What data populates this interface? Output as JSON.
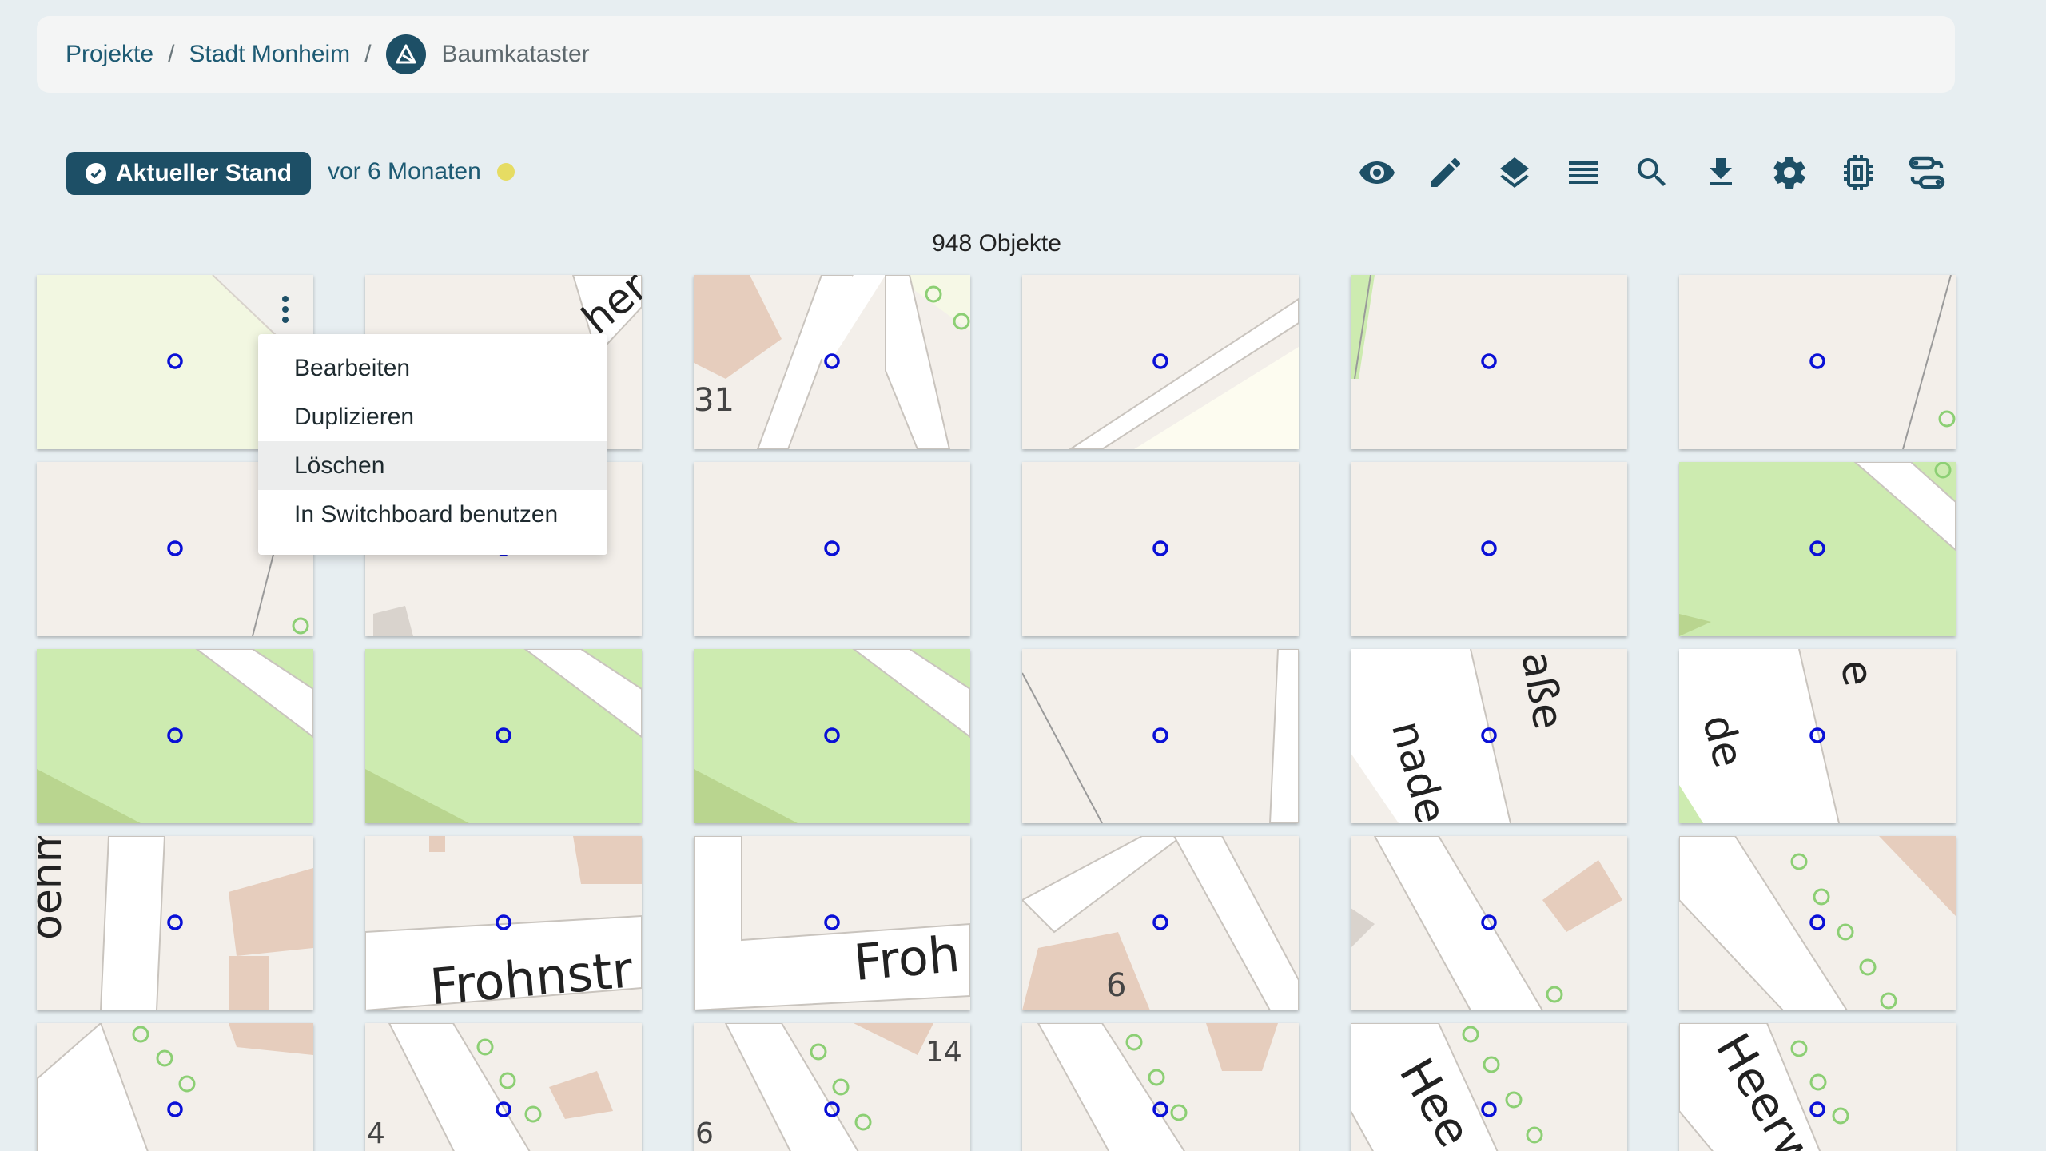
{
  "breadcrumb": {
    "items": [
      "Projekte",
      "Stadt Monheim"
    ],
    "separator": "/",
    "current": "Baumkataster"
  },
  "status": {
    "badge_label": "Aktueller Stand",
    "since_label": "vor 6 Monaten",
    "indicator_color": "#e6dc63"
  },
  "toolbar": {
    "icons": [
      "eye-icon",
      "pencil-icon",
      "layers-icon",
      "list-icon",
      "search-icon",
      "download-icon",
      "gear-icon",
      "chip-icon",
      "switchboard-icon"
    ]
  },
  "object_count": "948 Objekte",
  "context_menu": {
    "items": [
      "Bearbeiten",
      "Duplizieren",
      "Löschen",
      "In Switchboard benutzen"
    ],
    "hovered_index": 2
  },
  "map_labels": {
    "r1c3": "31",
    "r4c1": "oehm-S",
    "r4c2": "Frohnstr",
    "r4c3": "Froh",
    "r4c4": "6",
    "r3c5": "aße",
    "r3c5b": "nade",
    "r3c6": "e",
    "r3c6b": "de",
    "r5c2": "4",
    "r5c3": "14",
    "r5c3b": "6",
    "r5c5": "Hee",
    "r5c6": "Heerw",
    "r1c2": "her"
  },
  "colors": {
    "accent": "#1d4f66",
    "link": "#1d5a73",
    "marker": "#0a10d6",
    "map_bg": "#f2efe9",
    "map_green": "#cdebb0",
    "map_building": "#ddc5b5"
  }
}
